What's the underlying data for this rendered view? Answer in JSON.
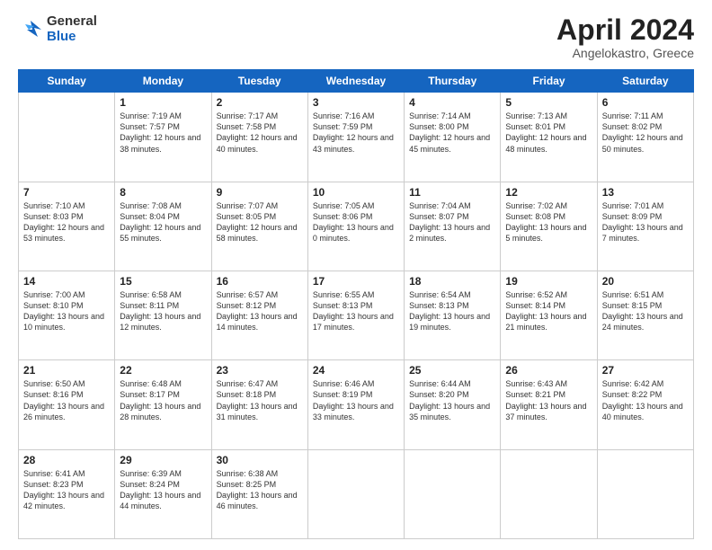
{
  "header": {
    "logo": {
      "general": "General",
      "blue": "Blue"
    },
    "title": "April 2024",
    "location": "Angelokastro, Greece"
  },
  "weekdays": [
    "Sunday",
    "Monday",
    "Tuesday",
    "Wednesday",
    "Thursday",
    "Friday",
    "Saturday"
  ],
  "weeks": [
    [
      {
        "day": "",
        "sunrise": "",
        "sunset": "",
        "daylight": ""
      },
      {
        "day": "1",
        "sunrise": "Sunrise: 7:19 AM",
        "sunset": "Sunset: 7:57 PM",
        "daylight": "Daylight: 12 hours and 38 minutes."
      },
      {
        "day": "2",
        "sunrise": "Sunrise: 7:17 AM",
        "sunset": "Sunset: 7:58 PM",
        "daylight": "Daylight: 12 hours and 40 minutes."
      },
      {
        "day": "3",
        "sunrise": "Sunrise: 7:16 AM",
        "sunset": "Sunset: 7:59 PM",
        "daylight": "Daylight: 12 hours and 43 minutes."
      },
      {
        "day": "4",
        "sunrise": "Sunrise: 7:14 AM",
        "sunset": "Sunset: 8:00 PM",
        "daylight": "Daylight: 12 hours and 45 minutes."
      },
      {
        "day": "5",
        "sunrise": "Sunrise: 7:13 AM",
        "sunset": "Sunset: 8:01 PM",
        "daylight": "Daylight: 12 hours and 48 minutes."
      },
      {
        "day": "6",
        "sunrise": "Sunrise: 7:11 AM",
        "sunset": "Sunset: 8:02 PM",
        "daylight": "Daylight: 12 hours and 50 minutes."
      }
    ],
    [
      {
        "day": "7",
        "sunrise": "Sunrise: 7:10 AM",
        "sunset": "Sunset: 8:03 PM",
        "daylight": "Daylight: 12 hours and 53 minutes."
      },
      {
        "day": "8",
        "sunrise": "Sunrise: 7:08 AM",
        "sunset": "Sunset: 8:04 PM",
        "daylight": "Daylight: 12 hours and 55 minutes."
      },
      {
        "day": "9",
        "sunrise": "Sunrise: 7:07 AM",
        "sunset": "Sunset: 8:05 PM",
        "daylight": "Daylight: 12 hours and 58 minutes."
      },
      {
        "day": "10",
        "sunrise": "Sunrise: 7:05 AM",
        "sunset": "Sunset: 8:06 PM",
        "daylight": "Daylight: 13 hours and 0 minutes."
      },
      {
        "day": "11",
        "sunrise": "Sunrise: 7:04 AM",
        "sunset": "Sunset: 8:07 PM",
        "daylight": "Daylight: 13 hours and 2 minutes."
      },
      {
        "day": "12",
        "sunrise": "Sunrise: 7:02 AM",
        "sunset": "Sunset: 8:08 PM",
        "daylight": "Daylight: 13 hours and 5 minutes."
      },
      {
        "day": "13",
        "sunrise": "Sunrise: 7:01 AM",
        "sunset": "Sunset: 8:09 PM",
        "daylight": "Daylight: 13 hours and 7 minutes."
      }
    ],
    [
      {
        "day": "14",
        "sunrise": "Sunrise: 7:00 AM",
        "sunset": "Sunset: 8:10 PM",
        "daylight": "Daylight: 13 hours and 10 minutes."
      },
      {
        "day": "15",
        "sunrise": "Sunrise: 6:58 AM",
        "sunset": "Sunset: 8:11 PM",
        "daylight": "Daylight: 13 hours and 12 minutes."
      },
      {
        "day": "16",
        "sunrise": "Sunrise: 6:57 AM",
        "sunset": "Sunset: 8:12 PM",
        "daylight": "Daylight: 13 hours and 14 minutes."
      },
      {
        "day": "17",
        "sunrise": "Sunrise: 6:55 AM",
        "sunset": "Sunset: 8:13 PM",
        "daylight": "Daylight: 13 hours and 17 minutes."
      },
      {
        "day": "18",
        "sunrise": "Sunrise: 6:54 AM",
        "sunset": "Sunset: 8:13 PM",
        "daylight": "Daylight: 13 hours and 19 minutes."
      },
      {
        "day": "19",
        "sunrise": "Sunrise: 6:52 AM",
        "sunset": "Sunset: 8:14 PM",
        "daylight": "Daylight: 13 hours and 21 minutes."
      },
      {
        "day": "20",
        "sunrise": "Sunrise: 6:51 AM",
        "sunset": "Sunset: 8:15 PM",
        "daylight": "Daylight: 13 hours and 24 minutes."
      }
    ],
    [
      {
        "day": "21",
        "sunrise": "Sunrise: 6:50 AM",
        "sunset": "Sunset: 8:16 PM",
        "daylight": "Daylight: 13 hours and 26 minutes."
      },
      {
        "day": "22",
        "sunrise": "Sunrise: 6:48 AM",
        "sunset": "Sunset: 8:17 PM",
        "daylight": "Daylight: 13 hours and 28 minutes."
      },
      {
        "day": "23",
        "sunrise": "Sunrise: 6:47 AM",
        "sunset": "Sunset: 8:18 PM",
        "daylight": "Daylight: 13 hours and 31 minutes."
      },
      {
        "day": "24",
        "sunrise": "Sunrise: 6:46 AM",
        "sunset": "Sunset: 8:19 PM",
        "daylight": "Daylight: 13 hours and 33 minutes."
      },
      {
        "day": "25",
        "sunrise": "Sunrise: 6:44 AM",
        "sunset": "Sunset: 8:20 PM",
        "daylight": "Daylight: 13 hours and 35 minutes."
      },
      {
        "day": "26",
        "sunrise": "Sunrise: 6:43 AM",
        "sunset": "Sunset: 8:21 PM",
        "daylight": "Daylight: 13 hours and 37 minutes."
      },
      {
        "day": "27",
        "sunrise": "Sunrise: 6:42 AM",
        "sunset": "Sunset: 8:22 PM",
        "daylight": "Daylight: 13 hours and 40 minutes."
      }
    ],
    [
      {
        "day": "28",
        "sunrise": "Sunrise: 6:41 AM",
        "sunset": "Sunset: 8:23 PM",
        "daylight": "Daylight: 13 hours and 42 minutes."
      },
      {
        "day": "29",
        "sunrise": "Sunrise: 6:39 AM",
        "sunset": "Sunset: 8:24 PM",
        "daylight": "Daylight: 13 hours and 44 minutes."
      },
      {
        "day": "30",
        "sunrise": "Sunrise: 6:38 AM",
        "sunset": "Sunset: 8:25 PM",
        "daylight": "Daylight: 13 hours and 46 minutes."
      },
      {
        "day": "",
        "sunrise": "",
        "sunset": "",
        "daylight": ""
      },
      {
        "day": "",
        "sunrise": "",
        "sunset": "",
        "daylight": ""
      },
      {
        "day": "",
        "sunrise": "",
        "sunset": "",
        "daylight": ""
      },
      {
        "day": "",
        "sunrise": "",
        "sunset": "",
        "daylight": ""
      }
    ]
  ]
}
